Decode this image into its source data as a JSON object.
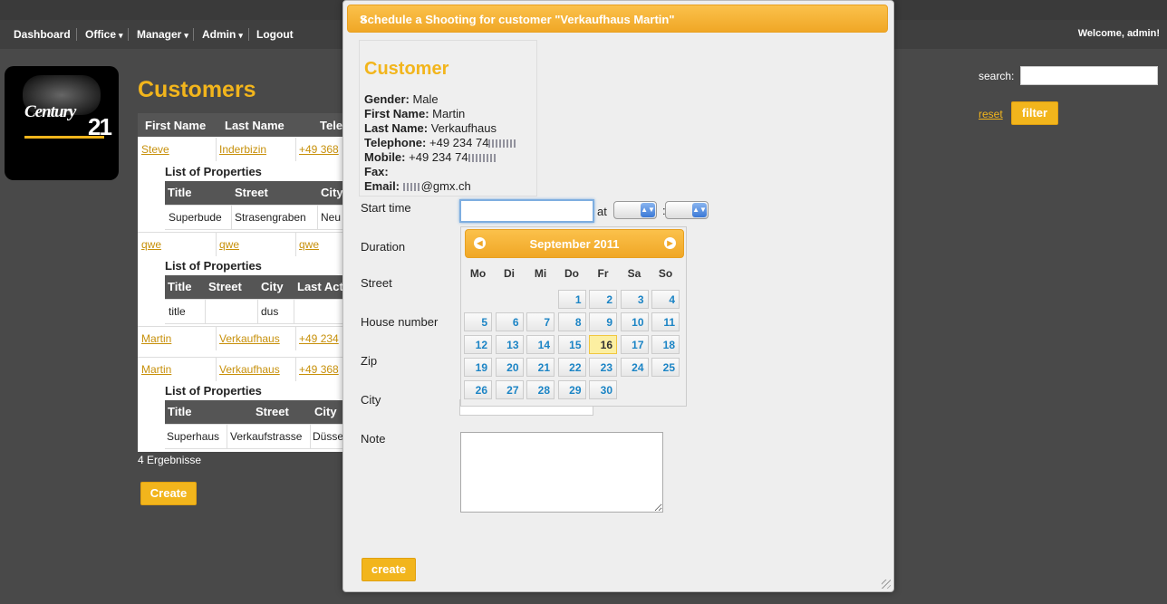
{
  "nav": {
    "items": [
      {
        "label": "Dashboard",
        "dropdown": false
      },
      {
        "label": "Office",
        "dropdown": true
      },
      {
        "label": "Manager",
        "dropdown": true
      },
      {
        "label": "Admin",
        "dropdown": true
      },
      {
        "label": "Logout",
        "dropdown": false
      }
    ],
    "welcome": "Welcome, admin!"
  },
  "logo": {
    "word": "Century",
    "number": "21"
  },
  "page": {
    "title": "Customers",
    "headers": [
      "First Name",
      "Last Name",
      "Tele"
    ],
    "customers": [
      {
        "first": "Steve",
        "last": "Inderbizin",
        "phone": "+49 368"
      },
      {
        "first": "qwe",
        "last": "qwe",
        "phone": "qwe"
      },
      {
        "first": "Martin",
        "last": "Verkaufhaus",
        "phone": "+49 234"
      },
      {
        "first": "Martin",
        "last": "Verkaufhaus",
        "phone": "+49 368"
      }
    ],
    "properties_title": "List of Properties",
    "prop1": {
      "headers": [
        "Title",
        "Street",
        "City"
      ],
      "row": [
        "Superbude",
        "Strasengraben",
        "Neu"
      ]
    },
    "prop2": {
      "headers": [
        "Title",
        "Street",
        "City",
        "Last Act"
      ],
      "row": [
        "title",
        "",
        "dus",
        ""
      ]
    },
    "prop3": {
      "headers": [
        "Title",
        "Street",
        "City"
      ],
      "row": [
        "Superhaus",
        "Verkaufstrasse",
        "Düsse"
      ]
    },
    "results": "4 Ergebnisse",
    "create_label": "Create"
  },
  "search": {
    "label": "search:",
    "value": "",
    "reset": "reset",
    "filter": "filter"
  },
  "dialog": {
    "title": "Schedule a Shooting for customer \"Verkaufhaus Martin\"",
    "close": "×",
    "customer": {
      "heading": "Customer",
      "gender_label": "Gender:",
      "gender": "Male",
      "first_label": "First Name:",
      "first": "Martin",
      "last_label": "Last Name:",
      "last": "Verkaufhaus",
      "tel_label": "Telephone:",
      "tel": "+49 234 74",
      "mobile_label": "Mobile:",
      "mobile": "+49 234 74",
      "fax_label": "Fax:",
      "fax": "",
      "email_label": "Email:",
      "email": "@gmx.ch"
    },
    "fields": {
      "start_time": "Start time",
      "at": "at",
      "colon": ":",
      "duration": "Duration",
      "street": "Street",
      "house_number": "House number",
      "zip": "Zip",
      "city": "City",
      "note": "Note"
    },
    "create_label": "create",
    "calendar": {
      "month": "September 2011",
      "weekdays": [
        "Mo",
        "Di",
        "Mi",
        "Do",
        "Fr",
        "Sa",
        "So"
      ],
      "days": [
        "1",
        "2",
        "3",
        "4",
        "5",
        "6",
        "7",
        "8",
        "9",
        "10",
        "11",
        "12",
        "13",
        "14",
        "15",
        "16",
        "17",
        "18",
        "19",
        "20",
        "21",
        "22",
        "23",
        "24",
        "25",
        "26",
        "27",
        "28",
        "29",
        "30"
      ],
      "today": "16"
    }
  }
}
